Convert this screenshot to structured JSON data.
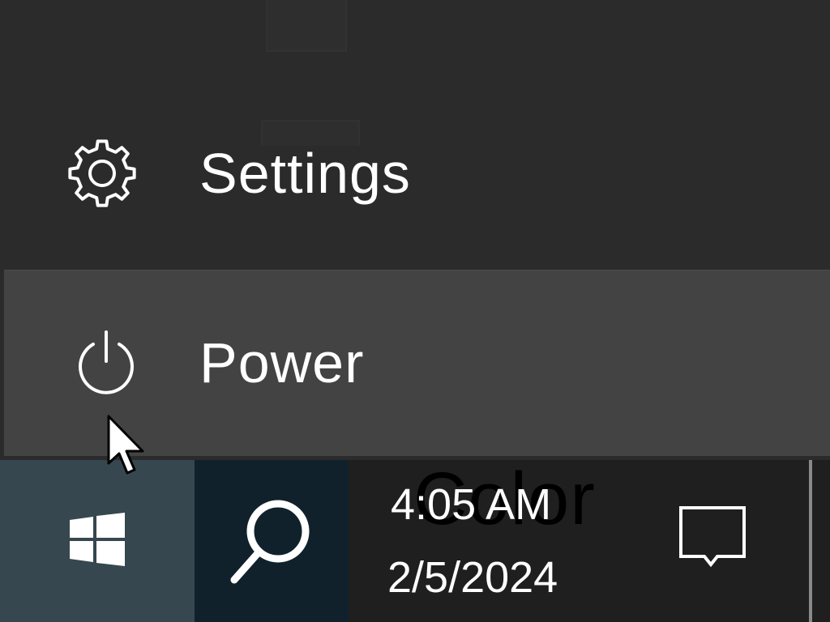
{
  "start_menu": {
    "settings_label": "Settings",
    "power_label": "Power",
    "settings_icon": "gear-icon",
    "power_icon": "power-icon"
  },
  "taskbar": {
    "start_icon": "windows-logo-icon",
    "search_icon": "search-icon",
    "clock": {
      "time": "4:05 AM",
      "date": "2/5/2024"
    },
    "overlap_text": "Color",
    "notification_icon": "notification-icon"
  },
  "colors": {
    "menu_background": "#2b2b2b",
    "hover_background": "#434343",
    "start_button": "#36474f",
    "search_button": "#10212b",
    "taskbar": "#1f1f1f"
  }
}
